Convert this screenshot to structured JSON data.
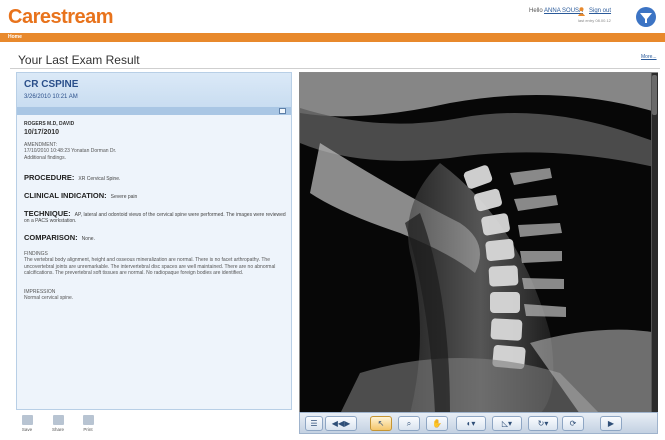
{
  "header": {
    "logo": "Carestream",
    "greeting": "Hello",
    "user": "ANNA SOUSA",
    "signout": "Sign out",
    "last_entry": "last entry 08.00.12",
    "brand_color": "#e8731c"
  },
  "nav": {
    "home": "Home",
    "color": "#e8892c"
  },
  "page": {
    "title": "Your Last Exam Result",
    "more": "More..."
  },
  "report": {
    "exam_title": "CR CSPINE",
    "exam_datetime": "3/26/2010 10:21 AM",
    "doctor": "ROGERS M.D, DAVID",
    "report_date": "10/17/2010",
    "amendment": "AMENDMENT:",
    "amendment_detail": "17/10/2010 10:48:23 Yonatan Dorman Dr.",
    "amendment_note": "Additional findings.",
    "procedure_label": "PROCEDURE:",
    "procedure": "XR Cervical Spine.",
    "indication_label": "CLINICAL INDICATION:",
    "indication": "Severe pain",
    "technique_label": "TECHNIQUE:",
    "technique": "AP, lateral and odontoid views of the cervical spine were performed. The images were reviewed on a PACS workstation.",
    "comparison_label": "COMPARISON:",
    "comparison": "None.",
    "findings_label": "FINDINGS",
    "findings": "The vertebral body alignment, height and osseous mineralization are normal. There is no facet arthropathy. The uncovertebral joints are unremarkable. The intervertebral disc spaces are well maintained. There are no abnormal calcifications. The prevertebral soft tissues are normal. No radiopaque foreign bodies are identified.",
    "impression_label": "IMPRESSION",
    "impression": "Normal cervical spine."
  },
  "actions": {
    "save": "Save",
    "share": "Share",
    "print": "Print"
  },
  "toolbar": {
    "icons": [
      "thumbnails-icon",
      "cine-icon",
      "pointer-icon",
      "zoom-icon",
      "pan-icon",
      "window-level-icon",
      "measure-icon",
      "rotate-icon",
      "reset-icon",
      "play-icon"
    ],
    "active": "pointer-icon"
  }
}
